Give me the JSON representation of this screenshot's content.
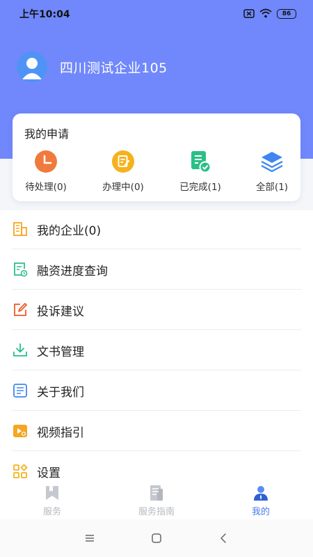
{
  "status_bar": {
    "time": "上午10:04",
    "battery": "86",
    "icons": [
      "sim-x-icon",
      "wifi-icon",
      "battery-icon"
    ]
  },
  "profile": {
    "company_name": "四川测试企业105",
    "avatar_icon": "user-avatar-icon"
  },
  "applications": {
    "title": "我的申请",
    "items": [
      {
        "label": "待处理(0)",
        "icon": "clock-icon",
        "color": "#f07a3c"
      },
      {
        "label": "办理中(0)",
        "icon": "edit-document-icon",
        "color": "#f5b21e"
      },
      {
        "label": "已完成(1)",
        "icon": "document-check-icon",
        "color": "#2bbf87"
      },
      {
        "label": "全部(1)",
        "icon": "layers-icon",
        "color": "#3f86f2"
      }
    ]
  },
  "menu": [
    {
      "label": "我的企业(0)",
      "icon": "building-icon",
      "color": "#f5a623"
    },
    {
      "label": "融资进度查询",
      "icon": "progress-query-icon",
      "color": "#2bbf87"
    },
    {
      "label": "投诉建议",
      "icon": "edit-pen-icon",
      "color": "#f05a28"
    },
    {
      "label": "文书管理",
      "icon": "download-icon",
      "color": "#2bbf87"
    },
    {
      "label": "关于我们",
      "icon": "about-list-icon",
      "color": "#3f86f2"
    },
    {
      "label": "视频指引",
      "icon": "video-icon",
      "color": "#f5a623"
    },
    {
      "label": "设置",
      "icon": "settings-grid-icon",
      "color": "#f5b21e"
    }
  ],
  "tabbar": {
    "tabs": [
      {
        "label": "服务",
        "icon": "service-bookmark-icon",
        "active": false
      },
      {
        "label": "服务指南",
        "icon": "guide-document-icon",
        "active": false
      },
      {
        "label": "我的",
        "icon": "profile-person-icon",
        "active": true
      }
    ],
    "active_color": "#4a78ee",
    "inactive_color": "#b5b8bf"
  },
  "system_nav": [
    "menu-lines-icon",
    "home-square-icon",
    "back-chevron-icon"
  ],
  "colors": {
    "header": "#7088fb",
    "avatar": "#4f93f7"
  }
}
